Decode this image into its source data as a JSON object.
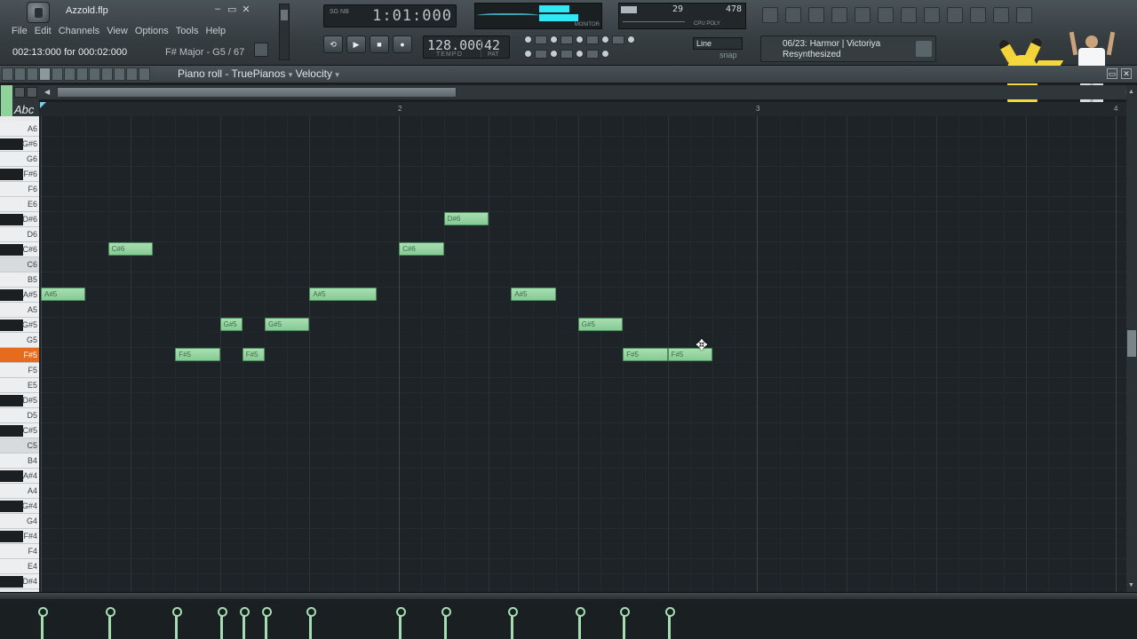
{
  "window": {
    "project_file": "Azzold.flp",
    "min": "–",
    "restore": "▭",
    "close": "✕"
  },
  "menu": [
    "File",
    "Edit",
    "Channels",
    "View",
    "Options",
    "Tools",
    "Help"
  ],
  "status": {
    "hint": "002:13:000 for 000:02:000",
    "scale": "F# Major - G5 / 67"
  },
  "transport": {
    "time_digits": "1:01:000",
    "time_labels": "SG\nNB",
    "tempo": "128.000",
    "tempo_label": "TEMPO",
    "pattern": "42",
    "pattern_label": "PAT",
    "buttons": [
      "⟲",
      "▶",
      "■",
      "●"
    ]
  },
  "meters": {
    "monitor_label": "MONITOR",
    "cpu_value": "29",
    "poly_value": "478",
    "cpu_label": "CPU  POLY"
  },
  "snap": {
    "value": "Line",
    "label": "snap"
  },
  "hint_panel": {
    "line1": "06/23: Harmor | Victoriya",
    "line2": "Resynthesized"
  },
  "piano_roll": {
    "title": "Piano roll - TruePianos",
    "target": "Velocity",
    "abc": "Abc",
    "bar_numbers": [
      "2",
      "3",
      "4"
    ],
    "keys": [
      "A6",
      "G#6",
      "G6",
      "F#6",
      "F6",
      "E6",
      "D#6",
      "D6",
      "C#6",
      "C6",
      "B5",
      "A#5",
      "A5",
      "G#5",
      "G5",
      "F#5",
      "F5",
      "E5",
      "D#5",
      "D5",
      "C#5",
      "C5",
      "B4",
      "A#4",
      "A4",
      "G#4",
      "G4",
      "F#4",
      "F4",
      "E4",
      "D#4"
    ],
    "highlighted_key": "F#5",
    "notes": [
      {
        "pitch": "A#5",
        "label": "A#5",
        "start_step": 0,
        "length_steps": 2
      },
      {
        "pitch": "C#6",
        "label": "C#6",
        "start_step": 3,
        "length_steps": 2
      },
      {
        "pitch": "F#5",
        "label": "F#5",
        "start_step": 6,
        "length_steps": 2
      },
      {
        "pitch": "G#5",
        "label": "G#5",
        "start_step": 8,
        "length_steps": 1
      },
      {
        "pitch": "F#5",
        "label": "F#5",
        "start_step": 9,
        "length_steps": 1
      },
      {
        "pitch": "G#5",
        "label": "G#5",
        "start_step": 10,
        "length_steps": 2
      },
      {
        "pitch": "A#5",
        "label": "A#5",
        "start_step": 12,
        "length_steps": 3
      },
      {
        "pitch": "C#6",
        "label": "C#6",
        "start_step": 16,
        "length_steps": 2
      },
      {
        "pitch": "D#6",
        "label": "D#6",
        "start_step": 18,
        "length_steps": 2
      },
      {
        "pitch": "A#5",
        "label": "A#5",
        "start_step": 21,
        "length_steps": 2
      },
      {
        "pitch": "G#5",
        "label": "G#5",
        "start_step": 24,
        "length_steps": 2
      },
      {
        "pitch": "F#5",
        "label": "F#5",
        "start_step": 26,
        "length_steps": 2
      },
      {
        "pitch": "F#5",
        "label": "F#5",
        "start_step": 28,
        "length_steps": 2
      }
    ],
    "velocity_steps": [
      0,
      3,
      6,
      8,
      9,
      10,
      12,
      16,
      18,
      21,
      24,
      26,
      28
    ]
  },
  "colors": {
    "note": "#a8dfb2",
    "highlight_key": "#e76b1d",
    "grid_bg": "#1d2326",
    "accent_cyan": "#31e6f5"
  }
}
